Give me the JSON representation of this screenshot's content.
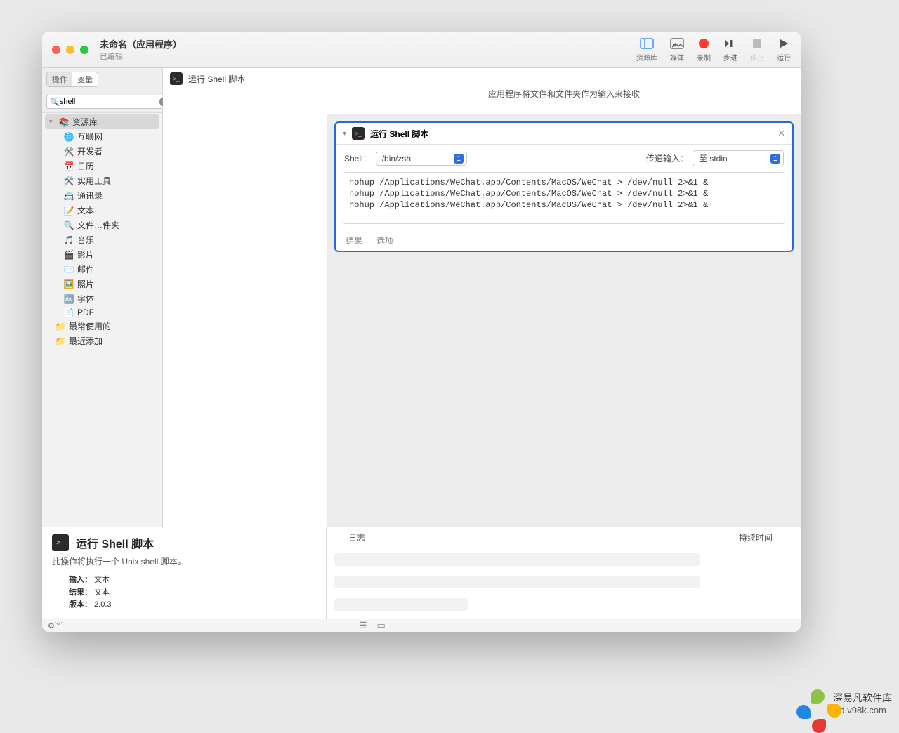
{
  "title": {
    "main": "未命名（应用程序）",
    "sub": "已编辑"
  },
  "toolbar": {
    "library": "资源库",
    "media": "媒体",
    "record": "录制",
    "step": "步进",
    "stop": "停止",
    "run": "运行"
  },
  "sidebar": {
    "seg_actions": "操作",
    "seg_vars": "变量",
    "search_value": "shell",
    "root": "资源库",
    "items": [
      {
        "icon": "🌐",
        "label": "互联网"
      },
      {
        "icon": "🛠️",
        "label": "开发者"
      },
      {
        "icon": "📅",
        "label": "日历"
      },
      {
        "icon": "🛠️",
        "label": "实用工具"
      },
      {
        "icon": "📇",
        "label": "通讯录"
      },
      {
        "icon": "📝",
        "label": "文本"
      },
      {
        "icon": "🔍",
        "label": "文件…件夹"
      },
      {
        "icon": "🎵",
        "label": "音乐"
      },
      {
        "icon": "🎬",
        "label": "影片"
      },
      {
        "icon": "✉️",
        "label": "邮件"
      },
      {
        "icon": "🖼️",
        "label": "照片"
      },
      {
        "icon": "🔤",
        "label": "字体"
      },
      {
        "icon": "📄",
        "label": "PDF"
      }
    ],
    "extra": [
      {
        "icon": "📁",
        "label": "最常使用的"
      },
      {
        "icon": "📁",
        "label": "最近添加"
      }
    ]
  },
  "actions": {
    "run_shell": "运行 Shell 脚本"
  },
  "drop_hint": "应用程序将文件和文件夹作为输入来接收",
  "step": {
    "title": "运行 Shell 脚本",
    "shell_label": "Shell：",
    "shell_value": "/bin/zsh",
    "pass_label": "传递输入：",
    "pass_value": "至 stdin",
    "code": "nohup /Applications/WeChat.app/Contents/MacOS/WeChat > /dev/null 2>&1 &\nnohup /Applications/WeChat.app/Contents/MacOS/WeChat > /dev/null 2>&1 &\nnohup /Applications/WeChat.app/Contents/MacOS/WeChat > /dev/null 2>&1 &",
    "foot_result": "结果",
    "foot_options": "选项"
  },
  "log": {
    "header_left": "日志",
    "header_right": "持续时间"
  },
  "detail": {
    "title": "运行 Shell 脚本",
    "desc": "此操作将执行一个 Unix shell 脚本。",
    "k_input": "输入：",
    "v_input": "文本",
    "k_result": "结果：",
    "v_result": "文本",
    "k_version": "版本：",
    "v_version": "2.0.3"
  },
  "watermark": {
    "line1": "深易凡软件库",
    "line2": "wd.v98k.com"
  }
}
